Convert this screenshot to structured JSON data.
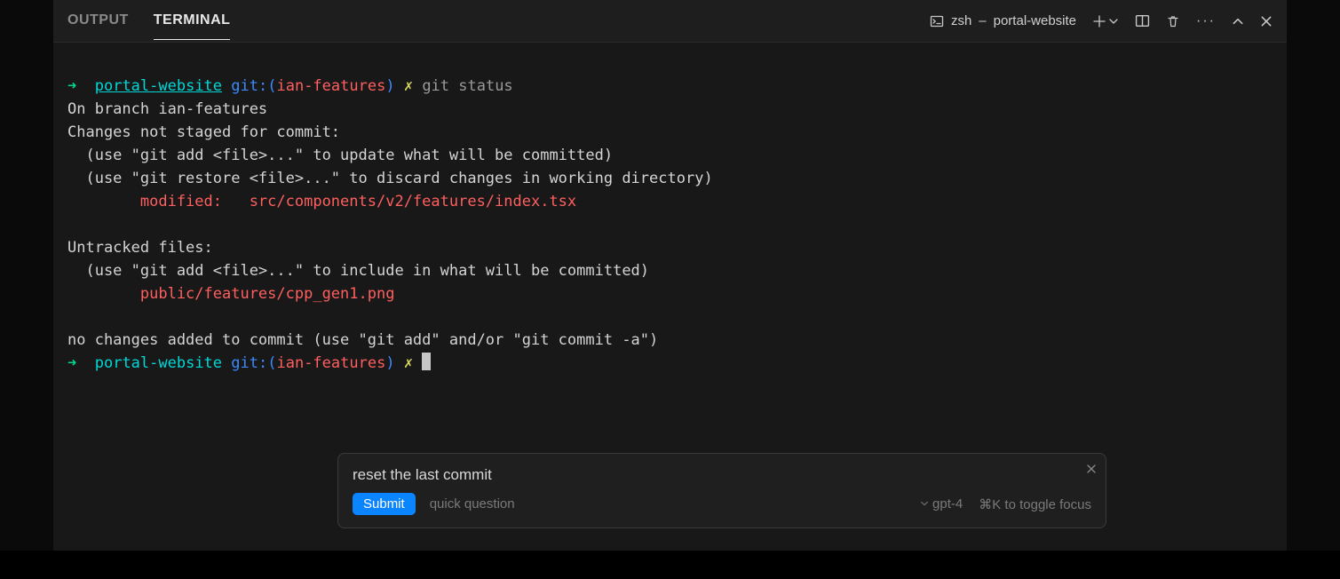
{
  "tabs": {
    "output": "OUTPUT",
    "terminal": "TERMINAL"
  },
  "terminal_header": {
    "shell": "zsh",
    "dash": " – ",
    "project": "portal-website"
  },
  "prompt": {
    "arrow": "➜",
    "cwd": "portal-website",
    "git_label": "git:",
    "open": "(",
    "branch": "ian-features",
    "close": ")",
    "dirty": "✗",
    "command": "git status"
  },
  "out": {
    "l1": "On branch ian-features",
    "l2": "Changes not staged for commit:",
    "l3": "  (use \"git add <file>...\" to update what will be committed)",
    "l4": "  (use \"git restore <file>...\" to discard changes in working directory)",
    "l5": "        modified:   src/components/v2/features/index.tsx",
    "l6": "",
    "l7": "Untracked files:",
    "l8": "  (use \"git add <file>...\" to include in what will be committed)",
    "l9": "        public/features/cpp_gen1.png",
    "l10": "",
    "l11": "no changes added to commit (use \"git add\" and/or \"git commit -a\")"
  },
  "ai": {
    "value": "reset the last commit",
    "submit": "Submit",
    "placeholder": "quick question",
    "model": "gpt-4",
    "focus_hint": "⌘K to toggle focus"
  }
}
